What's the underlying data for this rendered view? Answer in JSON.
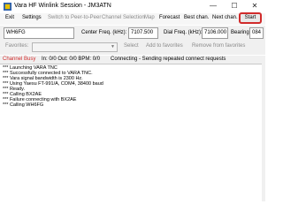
{
  "window": {
    "title": "Vara HF Winlink Session - JM3ATN",
    "controls": {
      "minimize": "—",
      "maximize": "☐",
      "close": "✕"
    }
  },
  "menu": {
    "exit": "Exit",
    "settings": "Settings",
    "switch_p2p": "Switch to Peer-to-Peer",
    "channel_selection": "Channel Selection",
    "map": "Map",
    "forecast": "Forecast",
    "best_chan": "Best chan.",
    "next_chan": "Next chan.",
    "start": "Start"
  },
  "connection": {
    "callsign": "WH6FG",
    "center_freq_label": "Center Freq. (kHz):",
    "center_freq": "7107.500",
    "dial_freq_label": "Dial Freq. (kHz):",
    "dial_freq": "7106.000",
    "bearing_label": "Bearing:",
    "bearing": "084"
  },
  "favorites": {
    "label": "Favorites:",
    "select": "Select",
    "add": "Add to favorites",
    "remove": "Remove from favorites"
  },
  "status": {
    "channel": "Channel Busy",
    "counts": "In: 0/0  Out: 0/0  BPM: 0/0",
    "message": "Connecting - Sending repeated connect requests"
  },
  "log": [
    "*** Launching VARA TNC",
    "*** Successfully connected to VARA TNC.",
    "*** Vara signal bandwidth is 2300 Hz.",
    "*** Using Yaesu FT-991/A, COM4, 38400 baud",
    "*** Ready.",
    "*** Calling BX2AE",
    "*** Failure connecting with BX2AE",
    "*** Calling WH6FG"
  ],
  "colors": {
    "highlight": "#d12b2b",
    "channel_busy": "#d12b2b"
  }
}
